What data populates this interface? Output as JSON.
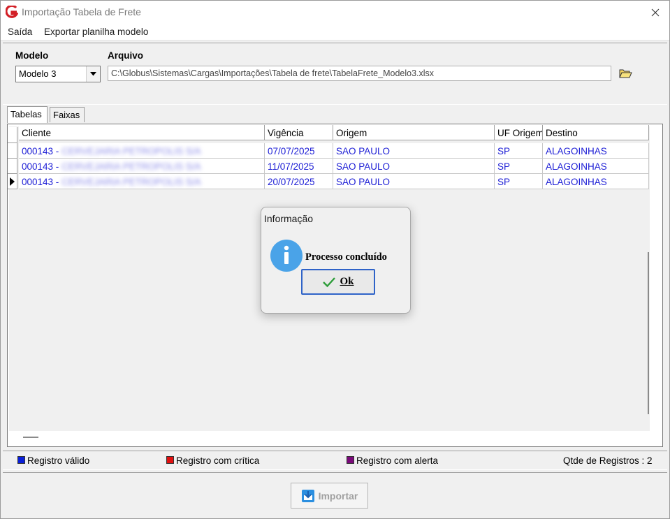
{
  "window": {
    "title": "Importação Tabela de Frete"
  },
  "menu": {
    "items": [
      "Saída",
      "Exportar planilha modelo"
    ]
  },
  "form": {
    "modelo_label": "Modelo",
    "modelo_value": "Modelo 3",
    "arquivo_label": "Arquivo",
    "arquivo_value": "C:\\Globus\\Sistemas\\Cargas\\Importações\\Tabela de frete\\TabelaFrete_Modelo3.xlsx"
  },
  "tabs": [
    {
      "label": "Tabelas",
      "active": true
    },
    {
      "label": "Faixas",
      "active": false
    }
  ],
  "grid": {
    "columns": [
      "Cliente",
      "Vigência",
      "Origem",
      "UF Origem",
      "Destino"
    ],
    "rows": [
      {
        "cliente_code": "000143 -",
        "cliente_name": "CERVEJARIA PETROPOLIS S/A",
        "vigencia": "07/07/2025",
        "origem": "SAO PAULO",
        "uf_origem": "SP",
        "destino": "ALAGOINHAS",
        "current": false
      },
      {
        "cliente_code": "000143 -",
        "cliente_name": "CERVEJARIA PETROPOLIS S/A",
        "vigencia": "11/07/2025",
        "origem": "SAO PAULO",
        "uf_origem": "SP",
        "destino": "ALAGOINHAS",
        "current": false
      },
      {
        "cliente_code": "000143 -",
        "cliente_name": "CERVEJARIA PETROPOLIS S/A",
        "vigencia": "20/07/2025",
        "origem": "SAO PAULO",
        "uf_origem": "SP",
        "destino": "ALAGOINHAS",
        "current": true
      }
    ],
    "row_text_color": "#1f20d6"
  },
  "legend": {
    "valid": {
      "label": "Registro válido",
      "color": "#0a1fd8"
    },
    "critica": {
      "label": "Registro com crítica",
      "color": "#e01010"
    },
    "alerta": {
      "label": "Registro com alerta",
      "color": "#7a0a7a"
    },
    "count_label": "Qtde de Registros : 2"
  },
  "import_button": {
    "label": "Importar",
    "enabled": false
  },
  "dialog": {
    "title": "Informação",
    "message": "Processo concluído",
    "ok_label": "Ok"
  }
}
